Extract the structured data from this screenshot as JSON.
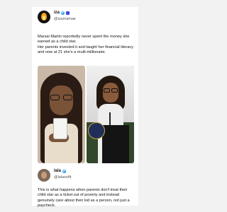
{
  "post": {
    "author_name": "iza",
    "author_handle": "@izamamae",
    "text_lines": [
      "Marsai Martin reportedly never spent the money she earned as a child star.",
      "Her parents invested it and taught her financial literacy and now at 21 she's a multi-millionaire."
    ]
  },
  "reply": {
    "author_name": "lala",
    "author_handle": "@lalasoftt",
    "text": "This is what happens when parents don't treat their child star as a ticket out of poverty and instead genuinely care about their kid as a person, not just a paycheck."
  },
  "colors": {
    "verified_badge": "#1d9bf0",
    "background": "#f2f2f2",
    "card": "#ffffff"
  }
}
